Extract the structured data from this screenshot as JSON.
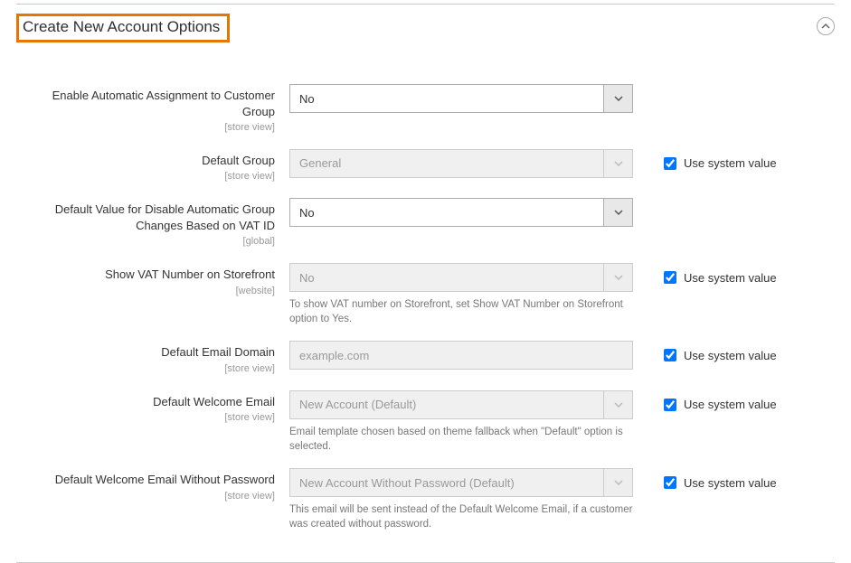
{
  "section": {
    "title": "Create New Account Options"
  },
  "use_system_value_label": "Use system value",
  "rows": [
    {
      "label": "Enable Automatic Assignment to Customer Group",
      "scope": "[store view]",
      "type": "select",
      "value": "No",
      "disabled": false,
      "system_checkbox": false,
      "hint": ""
    },
    {
      "label": "Default Group",
      "scope": "[store view]",
      "type": "select",
      "value": "General",
      "disabled": true,
      "system_checkbox": true,
      "hint": ""
    },
    {
      "label": "Default Value for Disable Automatic Group Changes Based on VAT ID",
      "scope": "[global]",
      "type": "select",
      "value": "No",
      "disabled": false,
      "system_checkbox": false,
      "hint": ""
    },
    {
      "label": "Show VAT Number on Storefront",
      "scope": "[website]",
      "type": "select",
      "value": "No",
      "disabled": true,
      "system_checkbox": true,
      "hint": "To show VAT number on Storefront, set Show VAT Number on Storefront option to Yes."
    },
    {
      "label": "Default Email Domain",
      "scope": "[store view]",
      "type": "text",
      "value": "example.com",
      "disabled": true,
      "system_checkbox": true,
      "hint": ""
    },
    {
      "label": "Default Welcome Email",
      "scope": "[store view]",
      "type": "select",
      "value": "New Account (Default)",
      "disabled": true,
      "system_checkbox": true,
      "hint": "Email template chosen based on theme fallback when \"Default\" option is selected."
    },
    {
      "label": "Default Welcome Email Without Password",
      "scope": "[store view]",
      "type": "select",
      "value": "New Account Without Password (Default)",
      "disabled": true,
      "system_checkbox": true,
      "hint": "This email will be sent instead of the Default Welcome Email, if a customer was created without password."
    }
  ]
}
